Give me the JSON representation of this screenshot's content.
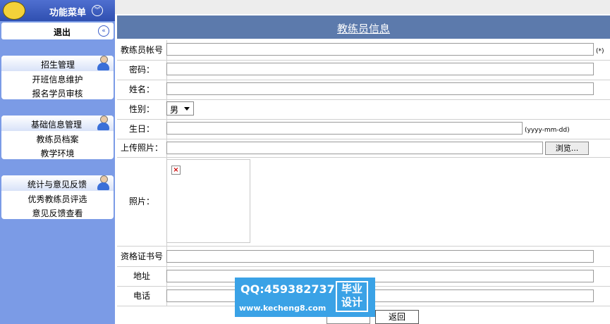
{
  "sidebar": {
    "menu_title": "功能菜单",
    "logout": "退出",
    "groups": [
      {
        "title": "招生管理",
        "items": [
          "开班信息维护",
          "报名学员审核"
        ]
      },
      {
        "title": "基础信息管理",
        "items": [
          "教练员档案",
          "教学环境"
        ]
      },
      {
        "title": "统计与意见反馈",
        "items": [
          "优秀教练员评选",
          "意见反馈查看"
        ]
      }
    ]
  },
  "form": {
    "title": "教练员信息",
    "labels": {
      "account": "教练员帐号",
      "password": "密码：",
      "name": "姓名：",
      "gender": "性别：",
      "birthday": "生日：",
      "upload": "上传照片：",
      "photo": "照片：",
      "cert": "资格证书号",
      "address": "地址",
      "phone": "电话"
    },
    "required_hint": "(*)",
    "date_hint": "(yyyy-mm-dd)",
    "gender_value": "男",
    "browse_label": "浏览...",
    "back_label": "返回"
  },
  "watermark": {
    "qq": "QQ:459382737",
    "url": "www.kecheng8.com",
    "badge_line1": "毕业",
    "badge_line2": "设计"
  },
  "icons": [
    "menu-logo-icon",
    "chevron-down-icon",
    "chevron-left-icon",
    "user-icon",
    "broken-image-icon"
  ]
}
